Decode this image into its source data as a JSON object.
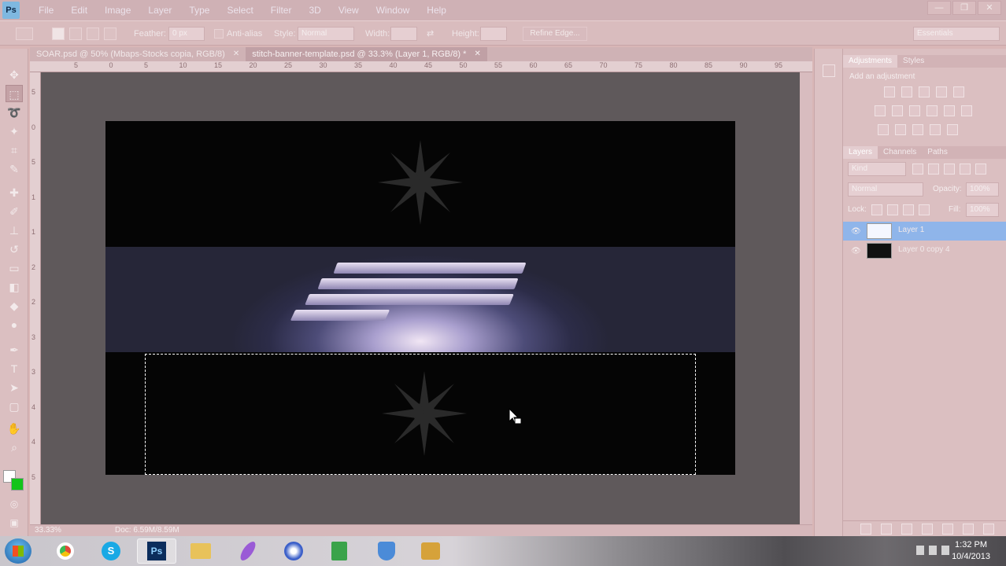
{
  "app": {
    "logo_text": "Ps"
  },
  "menu": [
    "File",
    "Edit",
    "Image",
    "Layer",
    "Type",
    "Select",
    "Filter",
    "3D",
    "View",
    "Window",
    "Help"
  ],
  "window_controls": {
    "minimize": "—",
    "restore": "❐",
    "close": "✕"
  },
  "options_bar": {
    "feather_label": "Feather:",
    "feather_value": "0 px",
    "antialias_label": "Anti-alias",
    "style_label": "Style:",
    "style_value": "Normal",
    "width_label": "Width:",
    "height_label": "Height:",
    "refine_edge_label": "Refine Edge...",
    "workspace_value": "Essentials"
  },
  "document_tabs": [
    {
      "title": "SOAR.psd @ 50% (Mbaps-Stocks copia, RGB/8)",
      "active": false
    },
    {
      "title": "stitch-banner-template.psd @ 33.3% (Layer 1, RGB/8) *",
      "active": true
    }
  ],
  "rulers": {
    "top": [
      "5",
      "0",
      "5",
      "10",
      "15",
      "20",
      "25",
      "30",
      "35",
      "40",
      "45",
      "50",
      "55",
      "60",
      "65",
      "70",
      "75",
      "80",
      "85",
      "90",
      "95"
    ],
    "left": [
      "5",
      "0",
      "5",
      "1",
      "1",
      "2",
      "2",
      "3",
      "3",
      "4",
      "4",
      "5"
    ]
  },
  "status_bar": {
    "zoom": "33.33%",
    "doc_info": "Doc: 6.59M/8.59M"
  },
  "panels": {
    "adjustments_tabs": [
      "Adjustments",
      "Styles"
    ],
    "adjustments_hint": "Add an adjustment",
    "layers_tabs": [
      "Layers",
      "Channels",
      "Paths"
    ],
    "kind_label": "Kind",
    "blend_mode": "Normal",
    "opacity_label": "Opacity:",
    "opacity_value": "100%",
    "lock_label": "Lock:",
    "fill_label": "Fill:",
    "fill_value": "100%",
    "layers": [
      {
        "name": "Layer 1",
        "selected": true,
        "thumb_color": "#f4f6ff"
      },
      {
        "name": "Layer 0 copy 4",
        "selected": false,
        "thumb_color": "#111111"
      }
    ]
  },
  "taskbar": {
    "apps": [
      {
        "name": "chrome",
        "label": "",
        "color": "#e04a3a"
      },
      {
        "name": "skype",
        "label": "S",
        "color": "#19a9e5"
      },
      {
        "name": "photoshop",
        "label": "Ps",
        "color": "#0b2d5c"
      },
      {
        "name": "explorer",
        "label": "",
        "color": "#e8c25a"
      },
      {
        "name": "feather-app",
        "label": "",
        "color": "#9a5bd6"
      },
      {
        "name": "browser",
        "label": "",
        "color": "#3b5fc9"
      },
      {
        "name": "media-app",
        "label": "",
        "color": "#3aa34a"
      },
      {
        "name": "shield-app",
        "label": "",
        "color": "#4b8bd8"
      },
      {
        "name": "tools-app",
        "label": "",
        "color": "#d6a23a"
      }
    ],
    "clock_time": "1:32 PM",
    "clock_date": "10/4/2013"
  }
}
